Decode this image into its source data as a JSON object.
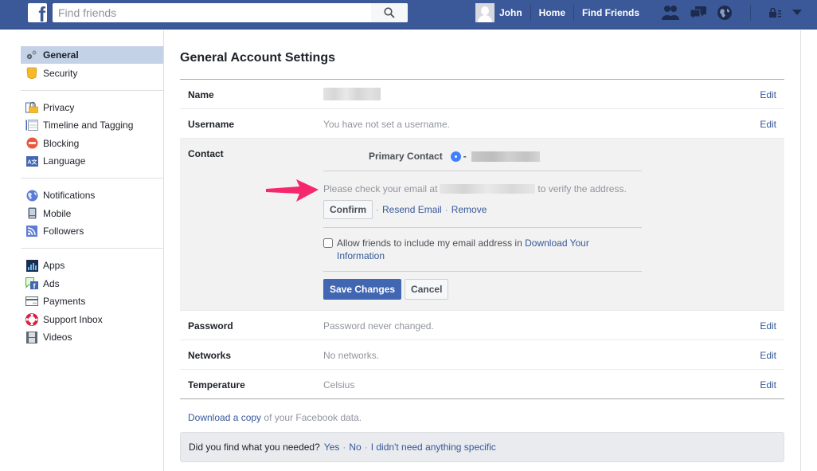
{
  "topbar": {
    "search_placeholder": "Find friends",
    "user_name": "John",
    "nav_links": [
      "Home",
      "Find Friends"
    ],
    "icons": [
      "friend-requests-icon",
      "messages-icon",
      "notifications-globe-icon",
      "privacy-shortcuts-icon",
      "account-menu-arrow-icon"
    ],
    "brand_color": "#3b5998"
  },
  "sidebar": {
    "groups": [
      [
        {
          "label": "General",
          "icon": "gears-icon",
          "active": true
        },
        {
          "label": "Security",
          "icon": "shield-badge-icon"
        }
      ],
      [
        {
          "label": "Privacy",
          "icon": "padlock-icon"
        },
        {
          "label": "Timeline and Tagging",
          "icon": "timeline-icon"
        },
        {
          "label": "Blocking",
          "icon": "blocking-icon"
        },
        {
          "label": "Language",
          "icon": "language-icon"
        }
      ],
      [
        {
          "label": "Notifications",
          "icon": "globe-icon"
        },
        {
          "label": "Mobile",
          "icon": "mobile-phone-icon"
        },
        {
          "label": "Followers",
          "icon": "rss-icon"
        }
      ],
      [
        {
          "label": "Apps",
          "icon": "apps-icon"
        },
        {
          "label": "Ads",
          "icon": "ads-icon"
        },
        {
          "label": "Payments",
          "icon": "credit-card-icon"
        },
        {
          "label": "Support Inbox",
          "icon": "lifebuoy-icon"
        },
        {
          "label": "Videos",
          "icon": "film-icon"
        }
      ]
    ]
  },
  "main": {
    "title": "General Account Settings",
    "rows": {
      "name": {
        "label": "Name",
        "value": "",
        "edit": "Edit"
      },
      "username": {
        "label": "Username",
        "value": "You have not set a username.",
        "edit": "Edit"
      },
      "contact": {
        "label": "Contact",
        "primary_label": "Primary Contact",
        "primary_dash": "-",
        "verify_prefix": "Please check your email at",
        "verify_suffix": "to verify the address.",
        "confirm_button": "Confirm",
        "resend_link": "Resend Email",
        "remove_link": "Remove",
        "separator": "·",
        "allow_text": "Allow friends to include my email address in",
        "allow_link": "Download Your Information",
        "allow_checked": false,
        "save_button": "Save Changes",
        "cancel_button": "Cancel"
      },
      "password": {
        "label": "Password",
        "value": "Password never changed.",
        "edit": "Edit"
      },
      "networks": {
        "label": "Networks",
        "value": "No networks.",
        "edit": "Edit"
      },
      "temperature": {
        "label": "Temperature",
        "value": "Celsius",
        "edit": "Edit"
      }
    },
    "download": {
      "link": "Download a copy",
      "text": " of your Facebook data."
    },
    "feedback": {
      "question": "Did you find what you needed?",
      "yes": "Yes",
      "no": "No",
      "nothing": "I didn't need anything specific",
      "separator": "·"
    }
  },
  "annotation": {
    "arrow_color": "#f5286e"
  }
}
